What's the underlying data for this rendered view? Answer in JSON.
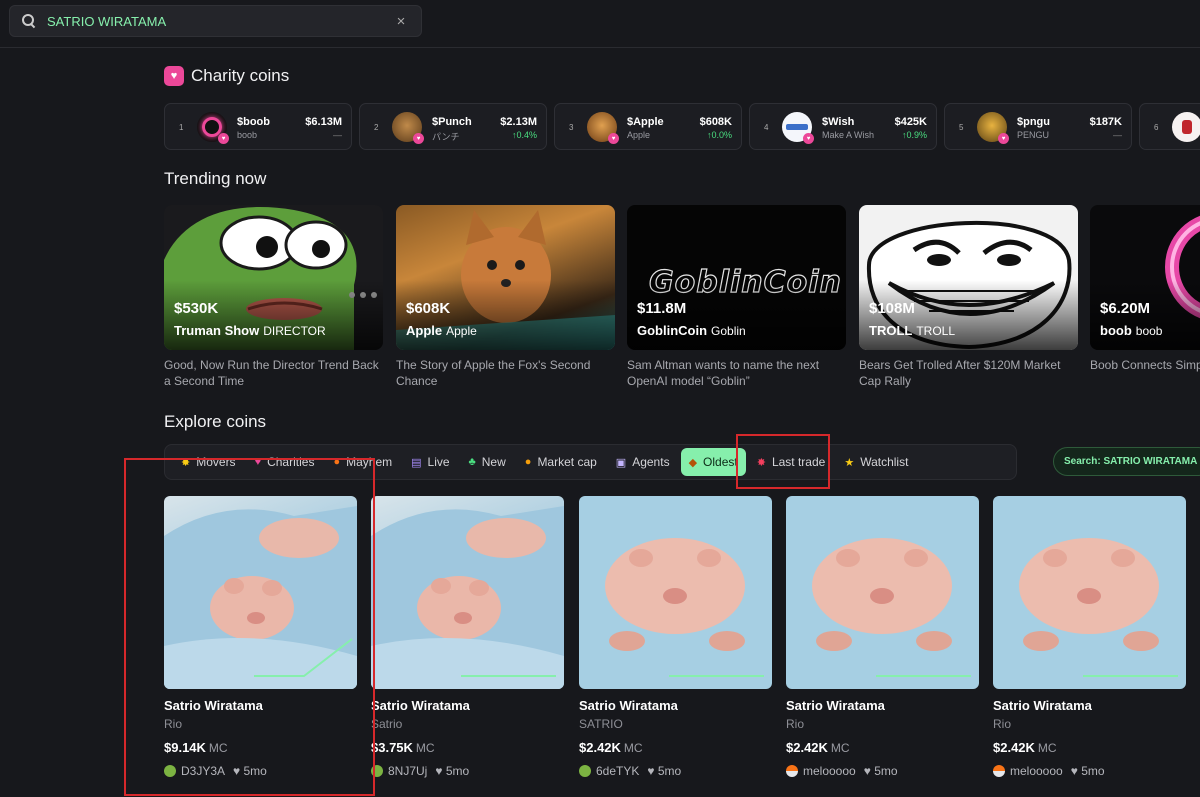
{
  "search": {
    "value": "SATRIO WIRATAMA",
    "clear_icon": "×"
  },
  "charity": {
    "title": "Charity coins",
    "items": [
      {
        "rank": "1",
        "ticker": "$boob",
        "name": "boob",
        "mc": "$6.13M",
        "change": "—"
      },
      {
        "rank": "2",
        "ticker": "$Punch",
        "name": "パンチ",
        "mc": "$2.13M",
        "change": "↑0.4%"
      },
      {
        "rank": "3",
        "ticker": "$Apple",
        "name": "Apple",
        "mc": "$608K",
        "change": "↑0.0%"
      },
      {
        "rank": "4",
        "ticker": "$Wish",
        "name": "Make A Wish",
        "mc": "$425K",
        "change": "↑0.9%"
      },
      {
        "rank": "5",
        "ticker": "$pngu",
        "name": "PENGU",
        "mc": "$187K",
        "change": "—"
      },
      {
        "rank": "6",
        "ticker": "",
        "name": "",
        "mc": "",
        "change": ""
      }
    ]
  },
  "trending": {
    "title": "Trending now",
    "items": [
      {
        "mc": "$530K",
        "name": "Truman Show",
        "sub": "DIRECTOR",
        "desc": "Good, Now Run the Director Trend Back a Second Time"
      },
      {
        "mc": "$608K",
        "name": "Apple",
        "sub": "Apple",
        "desc": "The Story of Apple the Fox's Second Chance"
      },
      {
        "mc": "$11.8M",
        "name": "GoblinCoin",
        "sub": "Goblin",
        "desc": "Sam Altman wants to name the next OpenAI model “Goblin”",
        "logo": "GoblinCoin"
      },
      {
        "mc": "$108M",
        "name": "TROLL",
        "sub": "TROLL",
        "desc": "Bears Get Trolled After $120M Market Cap Rally"
      },
      {
        "mc": "$6.20M",
        "name": "boob",
        "sub": "boob",
        "desc": "Boob Connects Simp World Cause"
      }
    ]
  },
  "explore": {
    "title": "Explore coins",
    "tabs": [
      {
        "icon": "✸",
        "label": "Movers"
      },
      {
        "icon": "♥",
        "label": "Charities"
      },
      {
        "icon": "●",
        "label": "Mayhem"
      },
      {
        "icon": "▤",
        "label": "Live"
      },
      {
        "icon": "♣",
        "label": "New"
      },
      {
        "icon": "●",
        "label": "Market cap"
      },
      {
        "icon": "▣",
        "label": "Agents"
      },
      {
        "icon": "◆",
        "label": "Oldest"
      },
      {
        "icon": "✸",
        "label": "Last trade"
      },
      {
        "icon": "★",
        "label": "Watchlist"
      }
    ],
    "active_tab": "Oldest",
    "search_pill": "Search: SATRIO WIRATAMA",
    "coins": [
      {
        "title": "Satrio Wiratama",
        "nick": "Rio",
        "mc": "$9.14K",
        "mc_label": "MC",
        "creator": "D3JY3A",
        "age": "5mo"
      },
      {
        "title": "Satrio Wiratama",
        "nick": "Satrio",
        "mc": "$3.75K",
        "mc_label": "MC",
        "creator": "8NJ7Uj",
        "age": "5mo"
      },
      {
        "title": "Satrio Wiratama",
        "nick": "SATRIO",
        "mc": "$2.42K",
        "mc_label": "MC",
        "creator": "6deTYK",
        "age": "5mo"
      },
      {
        "title": "Satrio Wiratama",
        "nick": "Rio",
        "mc": "$2.42K",
        "mc_label": "MC",
        "creator": "melooooo",
        "age": "5mo"
      },
      {
        "title": "Satrio Wiratama",
        "nick": "Rio",
        "mc": "$2.42K",
        "mc_label": "MC",
        "creator": "melooooo",
        "age": "5mo"
      }
    ]
  },
  "colors": {
    "accent": "#86efac",
    "charity": "#ec4899",
    "background": "#17181c",
    "highlight_box": "#d6282b"
  }
}
